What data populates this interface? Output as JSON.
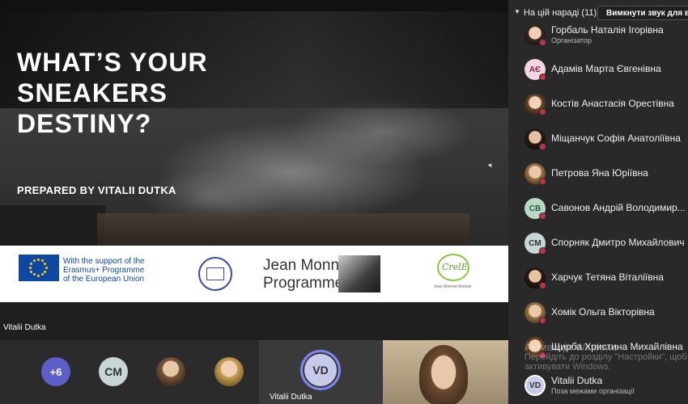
{
  "slide": {
    "title_lines": [
      "WHAT’S YOUR",
      "SNEAKERS",
      "DESTINY?"
    ],
    "subtitle": "PREPARED BY VITALII DUTKA",
    "logos": {
      "eu_lines": [
        "With the support of the",
        "Erasmus+ Programme",
        "of the European Union"
      ],
      "jean_monnet_lines": [
        "Jean Monnet",
        "Programme"
      ],
      "cre_logo": "CrelE",
      "cre_caption": "Jean Monnet Module"
    }
  },
  "presenter_label": "Vitalii Dutka",
  "strip": {
    "more_count": "+6",
    "cm_initials": "CM",
    "vd_initials": "VD",
    "vd_name": "Vitalii Dutka"
  },
  "panel": {
    "header": "На цій нараді (11)",
    "mute_button": "Вимкнути звук для всіх",
    "participants": [
      {
        "name": "Горбаль Наталія Ігорівна",
        "role": "Організатор",
        "avatar": "photo1",
        "initials": ""
      },
      {
        "name": "Адамів Марта Євгенівна",
        "role": "",
        "avatar": "init-ae",
        "initials": "АЄ"
      },
      {
        "name": "Костів Анастасія Орестівна",
        "role": "",
        "avatar": "photo2",
        "initials": ""
      },
      {
        "name": "Міщанчук Софія Анатоліївна",
        "role": "",
        "avatar": "photo4",
        "initials": ""
      },
      {
        "name": "Петрова Яна Юріївна",
        "role": "",
        "avatar": "photo3",
        "initials": ""
      },
      {
        "name": "Савонов Андрій Володимир...",
        "role": "",
        "avatar": "init-sb",
        "initials": "СВ"
      },
      {
        "name": "Спорняк Дмитро Михайлович",
        "role": "",
        "avatar": "init-cm",
        "initials": "СМ"
      },
      {
        "name": "Харчук Тетяна Віталіївна",
        "role": "",
        "avatar": "photo4",
        "initials": ""
      },
      {
        "name": "Хомік Ольга Вікторівна",
        "role": "",
        "avatar": "photo3",
        "initials": ""
      },
      {
        "name": "Щирба Христина Михайлівна",
        "role": "",
        "avatar": "photo2",
        "initials": ""
      },
      {
        "name": "Vitalii Dutka",
        "role": "Поза межами організації",
        "avatar": "init-vd",
        "initials": "VD"
      }
    ]
  },
  "watermark": {
    "line1": "Активація Windows",
    "line2": "Перейдіть до розділу \"Настройки\", щоб",
    "line3": "активувати Windows."
  },
  "colors": {
    "accent": "#5b5fc7",
    "ring": "#7f85f5",
    "busy": "#c4314b",
    "eu_blue": "#0e47a1"
  }
}
